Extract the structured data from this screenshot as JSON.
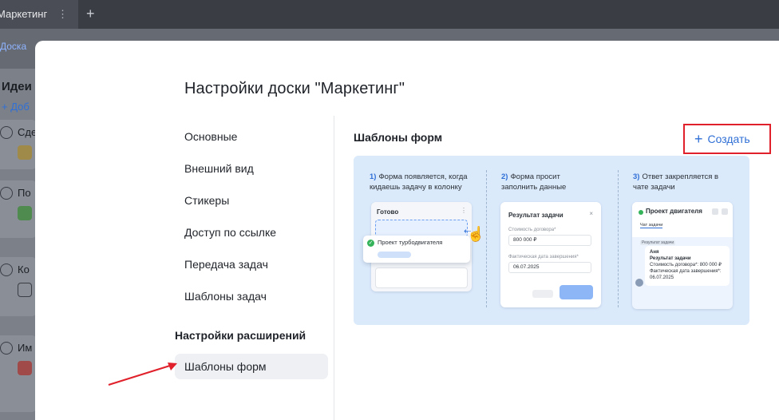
{
  "background": {
    "tab_label": "Маркетинг",
    "tab_menu_glyph": "⋮",
    "new_tab_glyph": "+",
    "board_link": "Доска",
    "column_title": "Идеи",
    "add_label": "+ Доб",
    "cards": [
      "Сде",
      "По",
      "Ко",
      "Им"
    ]
  },
  "modal": {
    "title": "Настройки доски \"Маркетинг\"",
    "nav": {
      "items": [
        "Основные",
        "Внешний вид",
        "Стикеры",
        "Доступ по ссылке",
        "Передача задач",
        "Шаблоны задач"
      ],
      "group_title": "Настройки расширений",
      "active_item": "Шаблоны форм"
    },
    "content": {
      "section_title": "Шаблоны форм",
      "create_label": "Создать",
      "create_icon": "plus-icon",
      "accent_color": "#2f6fd6",
      "highlight_color": "#e0212b"
    },
    "illustration": {
      "steps": [
        {
          "num": "1)",
          "text": "Форма появляется, когда кидаешь задачу в колонку"
        },
        {
          "num": "2)",
          "text": "Форма просит заполнить данные"
        },
        {
          "num": "3)",
          "text": "Ответ закрепляется в чате задачи"
        }
      ],
      "mock1": {
        "column_title": "Готово",
        "card_title": "Проект турбодвигателя"
      },
      "mock2": {
        "title": "Результат задачи",
        "close_glyph": "×",
        "field1_label": "Стоимость договора*",
        "field1_value": "800 000 ₽",
        "field2_label": "Фактическая дата завершения*",
        "field2_value": "06.07.2025"
      },
      "mock3": {
        "title": "Проект двигателя",
        "tab": "Чат задачи",
        "chip": "Результат задачи",
        "author": "Аня",
        "chat_title": "Результат задачи",
        "chat_line1": "Стоимость договора*: 800 000 ₽",
        "chat_line2": "Фактическая дата завершения*:",
        "chat_line3": "06.07.2025"
      }
    }
  }
}
